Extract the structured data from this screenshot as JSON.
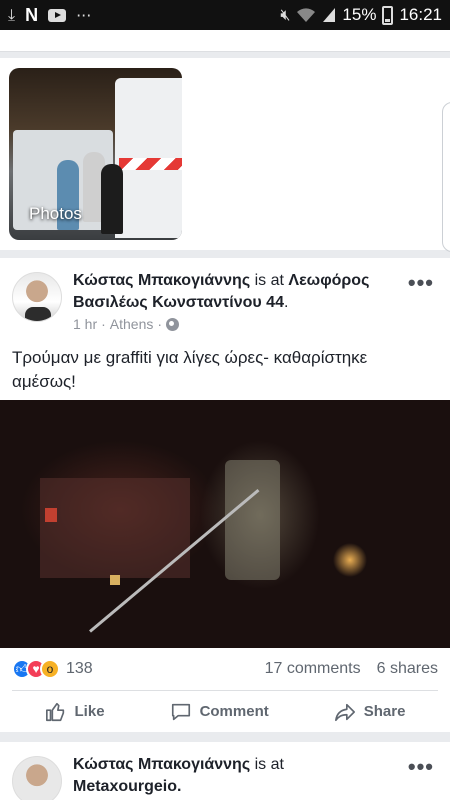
{
  "status_bar": {
    "battery": "15%",
    "time": "16:21",
    "icons": [
      "download-icon",
      "n-icon",
      "youtube-icon",
      "more-dots-icon",
      "mute-icon",
      "wifi-icon",
      "signal-icon",
      "battery-icon"
    ],
    "overflow": "···"
  },
  "photos_section": {
    "thumb_label": "Photos"
  },
  "post": {
    "author": "Κώστας Μπακογιάννης",
    "is_at": "is at",
    "place": "Λεωφόρος Βασιλέως Κωνσταντίνου 44",
    "meta_time": "1 hr",
    "meta_sep": "·",
    "meta_location": "Athens",
    "meta_dot": "·",
    "text": "Τρούμαν με graffiti για λίγες ώρες- καθαρίστηκε αμέσως!",
    "reaction_count": "138",
    "comments": "17 comments",
    "shares": "6 shares",
    "actions": {
      "like": "Like",
      "comment": "Comment",
      "share": "Share"
    },
    "more": "•••"
  },
  "next_post": {
    "author": "Κώστας Μπακογιάννης",
    "is_at": "is at",
    "place": "Metaxourgeio.",
    "more": "•••"
  },
  "colors": {
    "accent": "#1877f2",
    "love": "#f33e58",
    "wow": "#f7b125",
    "muted": "#90949c"
  }
}
